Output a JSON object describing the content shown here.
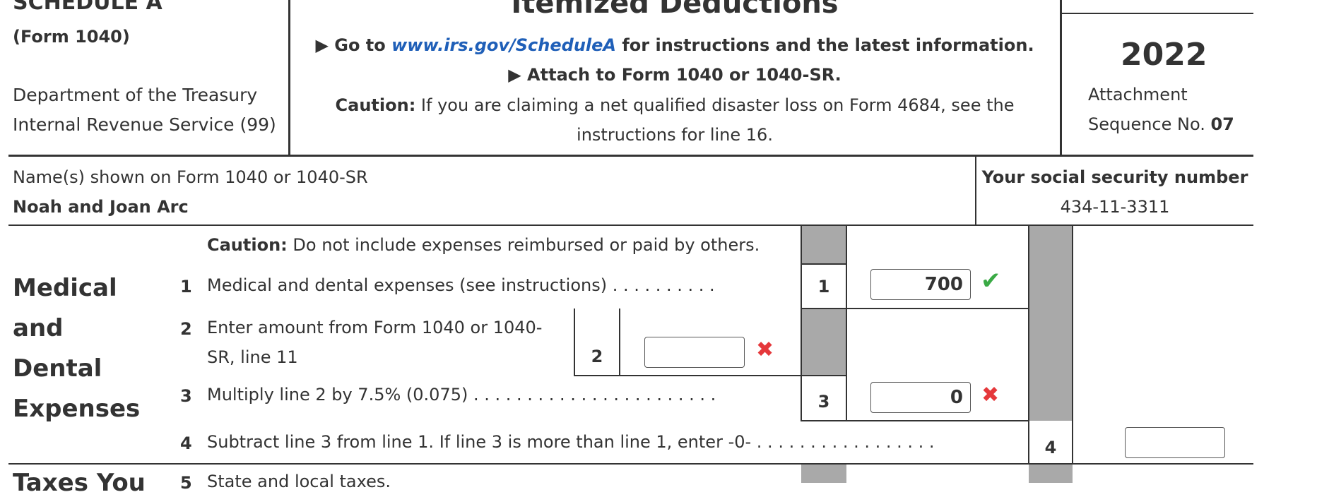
{
  "header": {
    "schedule": "SCHEDULE A",
    "form": "(Form 1040)",
    "dept1": "Department of the Treasury",
    "dept2": "Internal Revenue Service (99)",
    "title": "Itemized Deductions",
    "goto_pre": "Go to ",
    "goto_link": "www.irs.gov/ScheduleA",
    "goto_post": " for instructions and the latest information.",
    "attach": "Attach to Form 1040 or 1040-SR.",
    "caution_label": "Caution:",
    "caution_text": " If you are claiming a net qualified disaster loss on Form 4684, see the",
    "caution_text2": "instructions for line 16.",
    "year": "2022",
    "attachment": "Attachment",
    "sequence_label": "Sequence No. ",
    "sequence_no": "07"
  },
  "taxpayer": {
    "names_label": "Name(s) shown on Form 1040 or 1040-SR",
    "names_value": "Noah and Joan Arc",
    "ssn_label": "Your social security number",
    "ssn_value": "434-11-3311"
  },
  "section": {
    "title_lines": [
      "Medical",
      "and",
      "Dental",
      "Expenses"
    ],
    "next_title_partial": "Taxes You",
    "caution_label": "Caution:",
    "caution_text": " Do not include expenses reimbursed or paid by others."
  },
  "lines": {
    "l1": {
      "num": "1",
      "text": "Medical and dental expenses (see instructions)",
      "dots": ". . . . . . . . . .",
      "box": "1",
      "value": "700",
      "status": "correct"
    },
    "l2": {
      "num": "2",
      "text1": "Enter amount from Form 1040 or 1040-",
      "text2": "SR, line 11",
      "box": "2",
      "value": "",
      "status": "incorrect"
    },
    "l3": {
      "num": "3",
      "text": "Multiply line 2 by 7.5% (0.075)",
      "dots": ". . . . . . . . . . . . . . . . . . . . . . .",
      "box": "3",
      "value": "0",
      "status": "incorrect"
    },
    "l4": {
      "num": "4",
      "text": "Subtract line 3 from line 1. If line 3 is more than line 1, enter -0-",
      "dots": ". . . . . . . . . . . . . . . . .",
      "box": "4",
      "value": ""
    },
    "l5": {
      "num": "5",
      "text": "State and local taxes."
    }
  },
  "icons": {
    "check": "check-icon",
    "cross": "cross-icon",
    "arrow": "triangle-right-icon"
  },
  "colors": {
    "correct": "#3aaa45",
    "incorrect": "#e5383b",
    "link": "#1f5fb8",
    "shade": "#a9a9a9"
  }
}
